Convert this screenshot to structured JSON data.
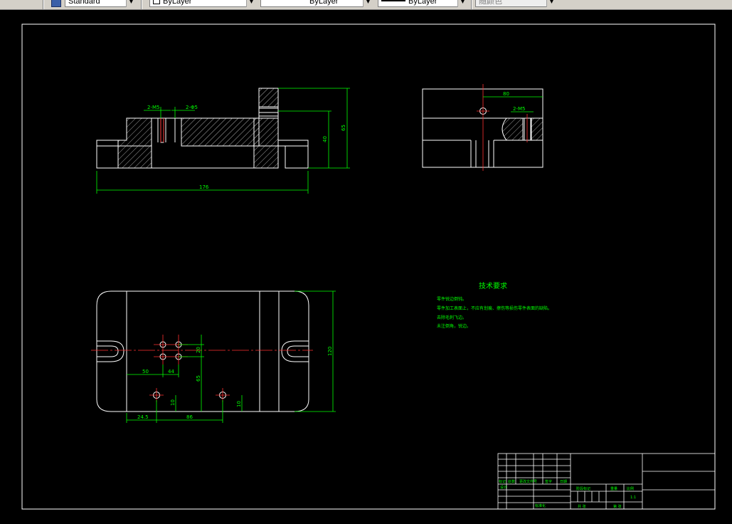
{
  "toolbar": {
    "text_style": "Standard",
    "layer_color": "ByLayer",
    "linetype": "ByLayer",
    "lineweight": "ByLayer",
    "plot_style": "随颜色"
  },
  "drawing": {
    "front_view": {
      "dim_overall_width": "176",
      "dim_hole_left": "2-M5",
      "dim_hole_right": "2-Φ5",
      "dim_height_inner": "40",
      "dim_height_outer": "65"
    },
    "side_view": {
      "dim_top": "80",
      "dim_hole": "2-M5"
    },
    "plan_view": {
      "dim_height": "120",
      "dim_x1": "50",
      "dim_x2": "44",
      "dim_y1": "20",
      "dim_y2": "65",
      "dim_y3": "10",
      "dim_y4": "10",
      "dim_bottom_left": "24.5",
      "dim_bottom_mid": "86"
    },
    "tech_requirements": {
      "title": "技术要求",
      "lines": [
        "零件锐边倒钝。",
        "零件加工表面上，不应有划痕、擦伤等损伤零件表面的缺陷。",
        "去除毛刺飞边。",
        "未注倒角，锐边。"
      ]
    },
    "title_block": {
      "mark": "标记",
      "count": "处数",
      "revision_doc": "更改文件号",
      "signature": "签字",
      "date": "日期",
      "designer": "设计",
      "standardization": "标准化",
      "stage_mark": "阶段标记",
      "weight": "重量",
      "scale": "比例",
      "scale_value": "1:1",
      "review": "审核",
      "process": "工艺",
      "approve": "批准",
      "sheet_total": "共 张",
      "sheet_num": "第 张"
    }
  },
  "colors": {
    "background": "#000000",
    "outline": "#ffffff",
    "dimension": "#00ff00",
    "centerline": "#ff0000",
    "hatch": "#ffffff"
  }
}
